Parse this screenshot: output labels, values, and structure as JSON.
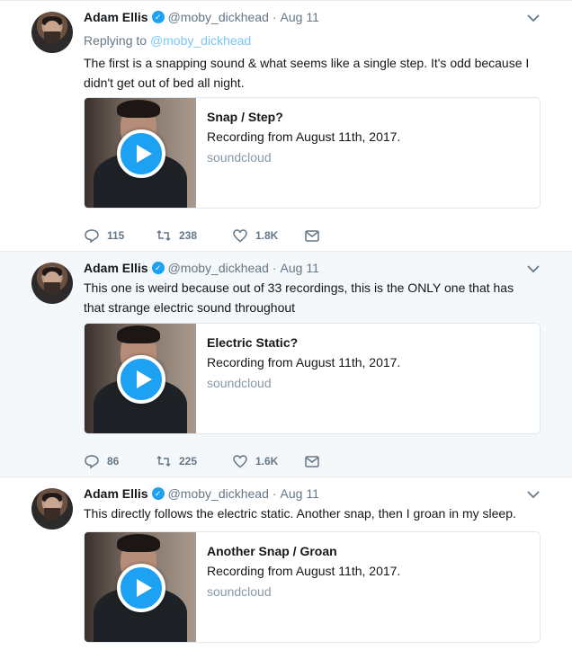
{
  "tweets": [
    {
      "name": "Adam Ellis",
      "handle": "@moby_dickhead",
      "separator": "·",
      "date": "Aug 11",
      "replying_label": "Replying to",
      "replying_handle": "@moby_dickhead",
      "text": "The first is a snapping sound & what seems like a single step. It's odd because I didn't get out of bed all night.",
      "card": {
        "title": "Snap / Step?",
        "description": "Recording from August 11th, 2017.",
        "domain": "soundcloud"
      },
      "replies": "115",
      "retweets": "238",
      "likes": "1.8K"
    },
    {
      "name": "Adam Ellis",
      "handle": "@moby_dickhead",
      "separator": "·",
      "date": "Aug 11",
      "text": "This one is weird because out of 33 recordings, this is the ONLY one that has that strange electric sound throughout",
      "card": {
        "title": "Electric Static?",
        "description": "Recording from August 11th, 2017.",
        "domain": "soundcloud"
      },
      "replies": "86",
      "retweets": "225",
      "likes": "1.6K"
    },
    {
      "name": "Adam Ellis",
      "handle": "@moby_dickhead",
      "separator": "·",
      "date": "Aug 11",
      "text": "This directly follows the electric static. Another snap, then I groan in my sleep.",
      "card": {
        "title": "Another Snap / Groan",
        "description": "Recording from August 11th, 2017.",
        "domain": "soundcloud"
      }
    }
  ],
  "colors": {
    "accent": "#1da1f2",
    "muted": "#657786",
    "highlight_bg": "#f5f8fa",
    "thread_line": "#ccd6dd"
  },
  "icons": [
    "verified-badge-icon",
    "caret-down-icon",
    "reply-icon",
    "retweet-icon",
    "heart-icon",
    "direct-message-icon",
    "play-icon"
  ]
}
